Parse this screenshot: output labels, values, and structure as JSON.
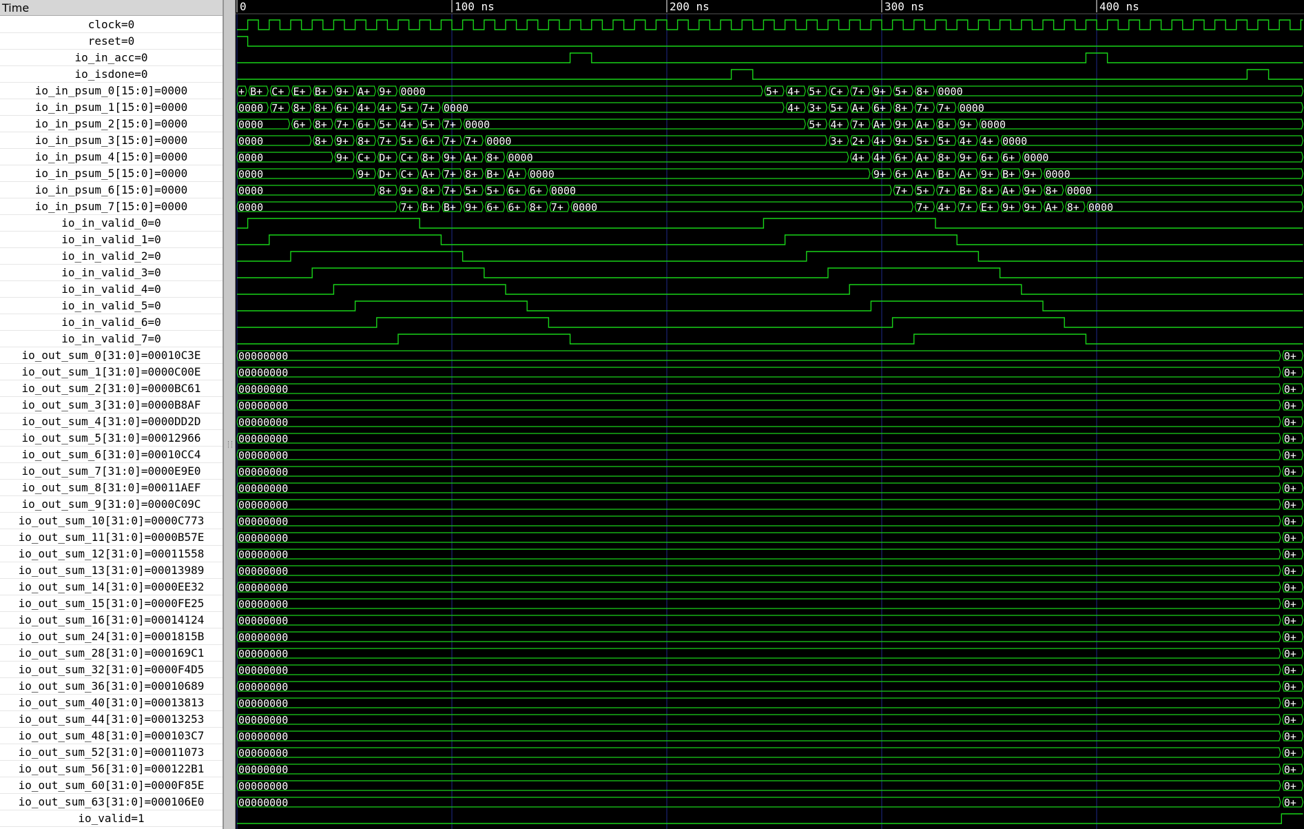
{
  "signal_panel": {
    "header": "Time",
    "signals": [
      {
        "name": "clock",
        "value": "0"
      },
      {
        "name": "reset",
        "value": "0"
      },
      {
        "name": "io_in_acc",
        "value": "0"
      },
      {
        "name": "io_isdone",
        "value": "0"
      },
      {
        "name": "io_in_psum_0[15:0]",
        "value": "0000"
      },
      {
        "name": "io_in_psum_1[15:0]",
        "value": "0000"
      },
      {
        "name": "io_in_psum_2[15:0]",
        "value": "0000"
      },
      {
        "name": "io_in_psum_3[15:0]",
        "value": "0000"
      },
      {
        "name": "io_in_psum_4[15:0]",
        "value": "0000"
      },
      {
        "name": "io_in_psum_5[15:0]",
        "value": "0000"
      },
      {
        "name": "io_in_psum_6[15:0]",
        "value": "0000"
      },
      {
        "name": "io_in_psum_7[15:0]",
        "value": "0000"
      },
      {
        "name": "io_in_valid_0",
        "value": "0"
      },
      {
        "name": "io_in_valid_1",
        "value": "0"
      },
      {
        "name": "io_in_valid_2",
        "value": "0"
      },
      {
        "name": "io_in_valid_3",
        "value": "0"
      },
      {
        "name": "io_in_valid_4",
        "value": "0"
      },
      {
        "name": "io_in_valid_5",
        "value": "0"
      },
      {
        "name": "io_in_valid_6",
        "value": "0"
      },
      {
        "name": "io_in_valid_7",
        "value": "0"
      },
      {
        "name": "io_out_sum_0[31:0]",
        "value": "00010C3E"
      },
      {
        "name": "io_out_sum_1[31:0]",
        "value": "0000C00E"
      },
      {
        "name": "io_out_sum_2[31:0]",
        "value": "0000BC61"
      },
      {
        "name": "io_out_sum_3[31:0]",
        "value": "0000B8AF"
      },
      {
        "name": "io_out_sum_4[31:0]",
        "value": "0000DD2D"
      },
      {
        "name": "io_out_sum_5[31:0]",
        "value": "00012966"
      },
      {
        "name": "io_out_sum_6[31:0]",
        "value": "00010CC4"
      },
      {
        "name": "io_out_sum_7[31:0]",
        "value": "0000E9E0"
      },
      {
        "name": "io_out_sum_8[31:0]",
        "value": "00011AEF"
      },
      {
        "name": "io_out_sum_9[31:0]",
        "value": "0000C09C"
      },
      {
        "name": "io_out_sum_10[31:0]",
        "value": "0000C773"
      },
      {
        "name": "io_out_sum_11[31:0]",
        "value": "0000B57E"
      },
      {
        "name": "io_out_sum_12[31:0]",
        "value": "00011558"
      },
      {
        "name": "io_out_sum_13[31:0]",
        "value": "00013989"
      },
      {
        "name": "io_out_sum_14[31:0]",
        "value": "0000EE32"
      },
      {
        "name": "io_out_sum_15[31:0]",
        "value": "0000FE25"
      },
      {
        "name": "io_out_sum_16[31:0]",
        "value": "00014124"
      },
      {
        "name": "io_out_sum_24[31:0]",
        "value": "0001815B"
      },
      {
        "name": "io_out_sum_28[31:0]",
        "value": "000169C1"
      },
      {
        "name": "io_out_sum_32[31:0]",
        "value": "0000F4D5"
      },
      {
        "name": "io_out_sum_36[31:0]",
        "value": "00010689"
      },
      {
        "name": "io_out_sum_40[31:0]",
        "value": "00013813"
      },
      {
        "name": "io_out_sum_44[31:0]",
        "value": "00013253"
      },
      {
        "name": "io_out_sum_48[31:0]",
        "value": "000103C7"
      },
      {
        "name": "io_out_sum_52[31:0]",
        "value": "00011073"
      },
      {
        "name": "io_out_sum_56[31:0]",
        "value": "000122B1"
      },
      {
        "name": "io_out_sum_60[31:0]",
        "value": "0000F85E"
      },
      {
        "name": "io_out_sum_63[31:0]",
        "value": "000106E0"
      },
      {
        "name": "io_valid",
        "value": "1"
      }
    ]
  },
  "timeline": {
    "ticks": [
      {
        "t": 0,
        "label": "0"
      },
      {
        "t": 100,
        "label": "100 ns"
      },
      {
        "t": 200,
        "label": "200 ns"
      },
      {
        "t": 300,
        "label": "300 ns"
      },
      {
        "t": 400,
        "label": "400 ns"
      }
    ],
    "visible_end_ns": 496,
    "clock_period_ns": 10
  },
  "waves": [
    {
      "type": "clock",
      "period": 10
    },
    {
      "type": "bit",
      "init": 1,
      "edges": [
        5
      ]
    },
    {
      "type": "bit",
      "init": 0,
      "edges": [
        155,
        165,
        395,
        405
      ]
    },
    {
      "type": "bit",
      "init": 0,
      "edges": [
        230,
        240,
        470,
        480
      ]
    },
    {
      "type": "bus",
      "segments": [
        [
          0,
          "+"
        ],
        [
          5,
          "B+"
        ],
        [
          15,
          "C+"
        ],
        [
          25,
          "E+"
        ],
        [
          35,
          "B+"
        ],
        [
          45,
          "9+"
        ],
        [
          55,
          "A+"
        ],
        [
          65,
          "9+"
        ],
        [
          75,
          "0000"
        ],
        [
          245,
          "5+"
        ],
        [
          255,
          "4+"
        ],
        [
          265,
          "5+"
        ],
        [
          275,
          "C+"
        ],
        [
          285,
          "7+"
        ],
        [
          295,
          "9+"
        ],
        [
          305,
          "5+"
        ],
        [
          315,
          "8+"
        ],
        [
          325,
          "0000"
        ]
      ]
    },
    {
      "type": "bus",
      "segments": [
        [
          0,
          "0000"
        ],
        [
          15,
          "7+"
        ],
        [
          25,
          "8+"
        ],
        [
          35,
          "8+"
        ],
        [
          45,
          "6+"
        ],
        [
          55,
          "4+"
        ],
        [
          65,
          "4+"
        ],
        [
          75,
          "5+"
        ],
        [
          85,
          "7+"
        ],
        [
          95,
          "0000"
        ],
        [
          255,
          "4+"
        ],
        [
          265,
          "3+"
        ],
        [
          275,
          "5+"
        ],
        [
          285,
          "A+"
        ],
        [
          295,
          "6+"
        ],
        [
          305,
          "8+"
        ],
        [
          315,
          "7+"
        ],
        [
          325,
          "7+"
        ],
        [
          335,
          "0000"
        ]
      ]
    },
    {
      "type": "bus",
      "segments": [
        [
          0,
          "0000"
        ],
        [
          25,
          "6+"
        ],
        [
          35,
          "8+"
        ],
        [
          45,
          "7+"
        ],
        [
          55,
          "6+"
        ],
        [
          65,
          "5+"
        ],
        [
          75,
          "4+"
        ],
        [
          85,
          "5+"
        ],
        [
          95,
          "7+"
        ],
        [
          105,
          "0000"
        ],
        [
          265,
          "5+"
        ],
        [
          275,
          "4+"
        ],
        [
          285,
          "7+"
        ],
        [
          295,
          "A+"
        ],
        [
          305,
          "9+"
        ],
        [
          315,
          "A+"
        ],
        [
          325,
          "8+"
        ],
        [
          335,
          "9+"
        ],
        [
          345,
          "0000"
        ]
      ]
    },
    {
      "type": "bus",
      "segments": [
        [
          0,
          "0000"
        ],
        [
          35,
          "8+"
        ],
        [
          45,
          "9+"
        ],
        [
          55,
          "8+"
        ],
        [
          65,
          "7+"
        ],
        [
          75,
          "5+"
        ],
        [
          85,
          "6+"
        ],
        [
          95,
          "7+"
        ],
        [
          105,
          "7+"
        ],
        [
          115,
          "0000"
        ],
        [
          275,
          "3+"
        ],
        [
          285,
          "2+"
        ],
        [
          295,
          "4+"
        ],
        [
          305,
          "9+"
        ],
        [
          315,
          "5+"
        ],
        [
          325,
          "5+"
        ],
        [
          335,
          "4+"
        ],
        [
          345,
          "4+"
        ],
        [
          355,
          "0000"
        ]
      ]
    },
    {
      "type": "bus",
      "segments": [
        [
          0,
          "0000"
        ],
        [
          45,
          "9+"
        ],
        [
          55,
          "C+"
        ],
        [
          65,
          "D+"
        ],
        [
          75,
          "C+"
        ],
        [
          85,
          "8+"
        ],
        [
          95,
          "9+"
        ],
        [
          105,
          "A+"
        ],
        [
          115,
          "8+"
        ],
        [
          125,
          "0000"
        ],
        [
          285,
          "4+"
        ],
        [
          295,
          "4+"
        ],
        [
          305,
          "6+"
        ],
        [
          315,
          "A+"
        ],
        [
          325,
          "8+"
        ],
        [
          335,
          "9+"
        ],
        [
          345,
          "6+"
        ],
        [
          355,
          "6+"
        ],
        [
          365,
          "0000"
        ]
      ]
    },
    {
      "type": "bus",
      "segments": [
        [
          0,
          "0000"
        ],
        [
          55,
          "9+"
        ],
        [
          65,
          "D+"
        ],
        [
          75,
          "C+"
        ],
        [
          85,
          "A+"
        ],
        [
          95,
          "7+"
        ],
        [
          105,
          "8+"
        ],
        [
          115,
          "B+"
        ],
        [
          125,
          "A+"
        ],
        [
          135,
          "0000"
        ],
        [
          295,
          "9+"
        ],
        [
          305,
          "6+"
        ],
        [
          315,
          "A+"
        ],
        [
          325,
          "B+"
        ],
        [
          335,
          "A+"
        ],
        [
          345,
          "9+"
        ],
        [
          355,
          "B+"
        ],
        [
          365,
          "9+"
        ],
        [
          375,
          "0000"
        ]
      ]
    },
    {
      "type": "bus",
      "segments": [
        [
          0,
          "0000"
        ],
        [
          65,
          "8+"
        ],
        [
          75,
          "9+"
        ],
        [
          85,
          "8+"
        ],
        [
          95,
          "7+"
        ],
        [
          105,
          "5+"
        ],
        [
          115,
          "5+"
        ],
        [
          125,
          "6+"
        ],
        [
          135,
          "6+"
        ],
        [
          145,
          "0000"
        ],
        [
          305,
          "7+"
        ],
        [
          315,
          "5+"
        ],
        [
          325,
          "7+"
        ],
        [
          335,
          "B+"
        ],
        [
          345,
          "8+"
        ],
        [
          355,
          "A+"
        ],
        [
          365,
          "9+"
        ],
        [
          375,
          "8+"
        ],
        [
          385,
          "0000"
        ]
      ]
    },
    {
      "type": "bus",
      "segments": [
        [
          0,
          "0000"
        ],
        [
          75,
          "7+"
        ],
        [
          85,
          "B+"
        ],
        [
          95,
          "B+"
        ],
        [
          105,
          "9+"
        ],
        [
          115,
          "6+"
        ],
        [
          125,
          "6+"
        ],
        [
          135,
          "8+"
        ],
        [
          145,
          "7+"
        ],
        [
          155,
          "0000"
        ],
        [
          315,
          "7+"
        ],
        [
          325,
          "4+"
        ],
        [
          335,
          "7+"
        ],
        [
          345,
          "E+"
        ],
        [
          355,
          "9+"
        ],
        [
          365,
          "9+"
        ],
        [
          375,
          "A+"
        ],
        [
          385,
          "8+"
        ],
        [
          395,
          "0000"
        ]
      ]
    },
    {
      "type": "bit",
      "init": 0,
      "edges": [
        5,
        85,
        245,
        325
      ]
    },
    {
      "type": "bit",
      "init": 0,
      "edges": [
        15,
        95,
        255,
        335
      ]
    },
    {
      "type": "bit",
      "init": 0,
      "edges": [
        25,
        105,
        265,
        345
      ]
    },
    {
      "type": "bit",
      "init": 0,
      "edges": [
        35,
        115,
        275,
        355
      ]
    },
    {
      "type": "bit",
      "init": 0,
      "edges": [
        45,
        125,
        285,
        365
      ]
    },
    {
      "type": "bit",
      "init": 0,
      "edges": [
        55,
        135,
        295,
        375
      ]
    },
    {
      "type": "bit",
      "init": 0,
      "edges": [
        65,
        145,
        305,
        385
      ]
    },
    {
      "type": "bit",
      "init": 0,
      "edges": [
        75,
        155,
        315,
        395
      ]
    },
    {
      "type": "bus",
      "segments": [
        [
          0,
          "00000000"
        ],
        [
          486,
          "0+"
        ]
      ]
    },
    {
      "type": "bus",
      "segments": [
        [
          0,
          "00000000"
        ],
        [
          486,
          "0+"
        ]
      ]
    },
    {
      "type": "bus",
      "segments": [
        [
          0,
          "00000000"
        ],
        [
          486,
          "0+"
        ]
      ]
    },
    {
      "type": "bus",
      "segments": [
        [
          0,
          "00000000"
        ],
        [
          486,
          "0+"
        ]
      ]
    },
    {
      "type": "bus",
      "segments": [
        [
          0,
          "00000000"
        ],
        [
          486,
          "0+"
        ]
      ]
    },
    {
      "type": "bus",
      "segments": [
        [
          0,
          "00000000"
        ],
        [
          486,
          "0+"
        ]
      ]
    },
    {
      "type": "bus",
      "segments": [
        [
          0,
          "00000000"
        ],
        [
          486,
          "0+"
        ]
      ]
    },
    {
      "type": "bus",
      "segments": [
        [
          0,
          "00000000"
        ],
        [
          486,
          "0+"
        ]
      ]
    },
    {
      "type": "bus",
      "segments": [
        [
          0,
          "00000000"
        ],
        [
          486,
          "0+"
        ]
      ]
    },
    {
      "type": "bus",
      "segments": [
        [
          0,
          "00000000"
        ],
        [
          486,
          "0+"
        ]
      ]
    },
    {
      "type": "bus",
      "segments": [
        [
          0,
          "00000000"
        ],
        [
          486,
          "0+"
        ]
      ]
    },
    {
      "type": "bus",
      "segments": [
        [
          0,
          "00000000"
        ],
        [
          486,
          "0+"
        ]
      ]
    },
    {
      "type": "bus",
      "segments": [
        [
          0,
          "00000000"
        ],
        [
          486,
          "0+"
        ]
      ]
    },
    {
      "type": "bus",
      "segments": [
        [
          0,
          "00000000"
        ],
        [
          486,
          "0+"
        ]
      ]
    },
    {
      "type": "bus",
      "segments": [
        [
          0,
          "00000000"
        ],
        [
          486,
          "0+"
        ]
      ]
    },
    {
      "type": "bus",
      "segments": [
        [
          0,
          "00000000"
        ],
        [
          486,
          "0+"
        ]
      ]
    },
    {
      "type": "bus",
      "segments": [
        [
          0,
          "00000000"
        ],
        [
          486,
          "0+"
        ]
      ]
    },
    {
      "type": "bus",
      "segments": [
        [
          0,
          "00000000"
        ],
        [
          486,
          "0+"
        ]
      ]
    },
    {
      "type": "bus",
      "segments": [
        [
          0,
          "00000000"
        ],
        [
          486,
          "0+"
        ]
      ]
    },
    {
      "type": "bus",
      "segments": [
        [
          0,
          "00000000"
        ],
        [
          486,
          "0+"
        ]
      ]
    },
    {
      "type": "bus",
      "segments": [
        [
          0,
          "00000000"
        ],
        [
          486,
          "0+"
        ]
      ]
    },
    {
      "type": "bus",
      "segments": [
        [
          0,
          "00000000"
        ],
        [
          486,
          "0+"
        ]
      ]
    },
    {
      "type": "bus",
      "segments": [
        [
          0,
          "00000000"
        ],
        [
          486,
          "0+"
        ]
      ]
    },
    {
      "type": "bus",
      "segments": [
        [
          0,
          "00000000"
        ],
        [
          486,
          "0+"
        ]
      ]
    },
    {
      "type": "bus",
      "segments": [
        [
          0,
          "00000000"
        ],
        [
          486,
          "0+"
        ]
      ]
    },
    {
      "type": "bus",
      "segments": [
        [
          0,
          "00000000"
        ],
        [
          486,
          "0+"
        ]
      ]
    },
    {
      "type": "bus",
      "segments": [
        [
          0,
          "00000000"
        ],
        [
          486,
          "0+"
        ]
      ]
    },
    {
      "type": "bus",
      "segments": [
        [
          0,
          "00000000"
        ],
        [
          486,
          "0+"
        ]
      ]
    },
    {
      "type": "bit",
      "init": 0,
      "edges": [
        486
      ]
    }
  ],
  "colors": {
    "wave": "#19d419",
    "background": "#000000",
    "grid": "#1e2a8a",
    "panel_bg": "#ffffff",
    "header_bg": "#d6d6d6"
  }
}
